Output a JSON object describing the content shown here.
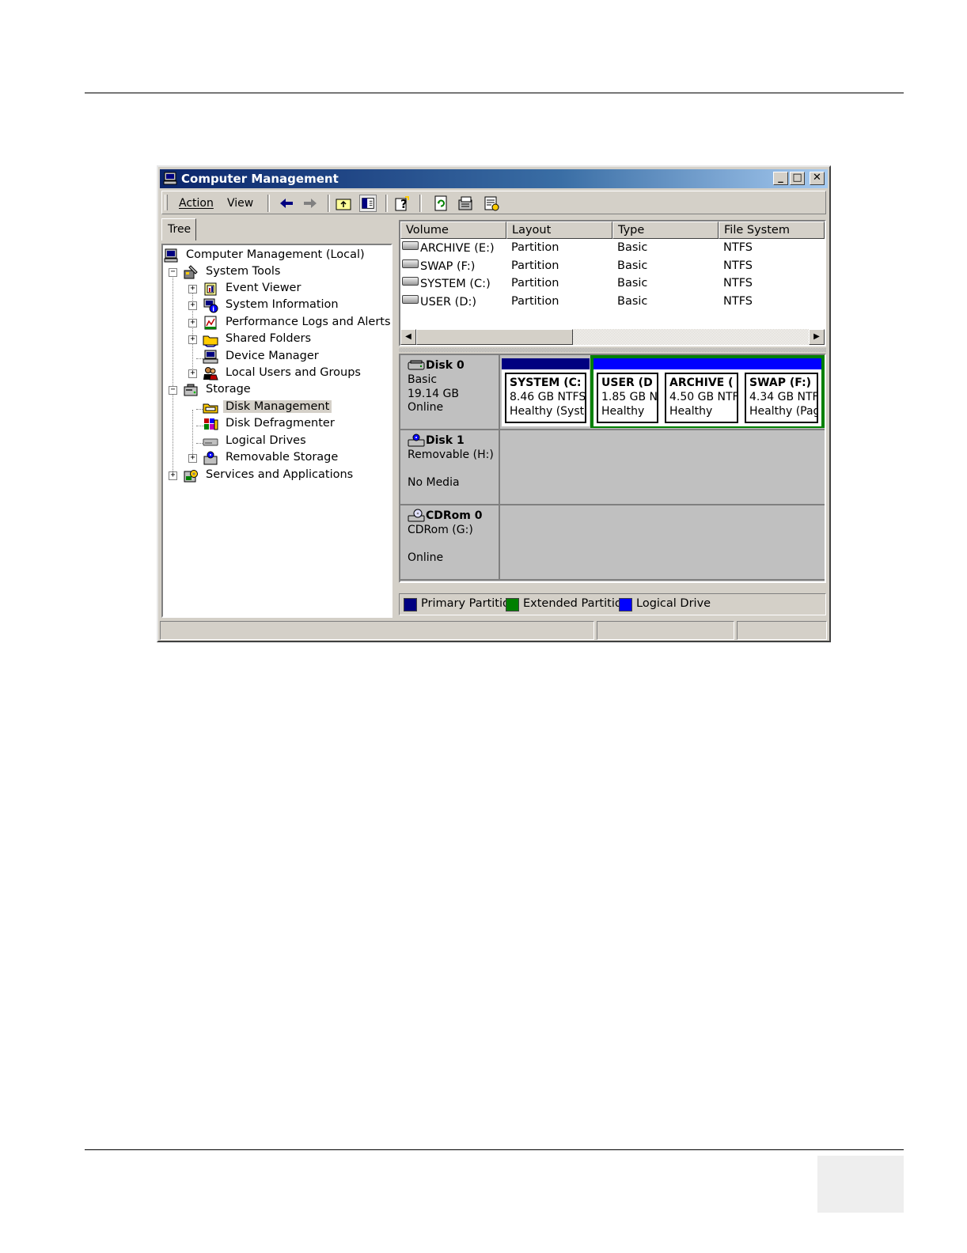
{
  "window": {
    "title": "Computer Management",
    "caption_buttons": [
      "_",
      "□",
      "✕"
    ]
  },
  "menu": {
    "action": "Action",
    "view": "View"
  },
  "toolbar_icons": [
    "back-icon",
    "forward-icon",
    "up-folder-icon",
    "show-hide-tree-icon",
    "help-icon",
    "refresh-icon",
    "properties-icon",
    "export-icon"
  ],
  "tree": {
    "tab": "Tree",
    "root": "Computer Management (Local)",
    "system_tools": "System Tools",
    "event_viewer": "Event Viewer",
    "system_information": "System Information",
    "performance_logs": "Performance Logs and Alerts",
    "shared_folders": "Shared Folders",
    "device_manager": "Device Manager",
    "local_users": "Local Users and Groups",
    "storage": "Storage",
    "disk_management": "Disk Management",
    "disk_defragmenter": "Disk Defragmenter",
    "logical_drives": "Logical Drives",
    "removable_storage": "Removable Storage",
    "services_apps": "Services and Applications"
  },
  "volumes": {
    "headers": [
      "Volume",
      "Layout",
      "Type",
      "File System"
    ],
    "rows": [
      [
        "ARCHIVE (E:)",
        "Partition",
        "Basic",
        "NTFS"
      ],
      [
        "SWAP (F:)",
        "Partition",
        "Basic",
        "NTFS"
      ],
      [
        "SYSTEM (C:)",
        "Partition",
        "Basic",
        "NTFS"
      ],
      [
        "USER (D:)",
        "Partition",
        "Basic",
        "NTFS"
      ]
    ]
  },
  "disks": {
    "disk0": {
      "name": "Disk 0",
      "type": "Basic",
      "size": "19.14 GB",
      "status": "Online",
      "partitions": [
        {
          "name": "SYSTEM (C:",
          "size": "8.46 GB NTFS",
          "status": "Healthy (Syste"
        },
        {
          "name": "USER (D",
          "size": "1.85 GB N",
          "status": "Healthy"
        },
        {
          "name": "ARCHIVE (",
          "size": "4.50 GB NTF",
          "status": "Healthy"
        },
        {
          "name": "SWAP (F:)",
          "size": "4.34 GB NTF",
          "status": "Healthy (Pag"
        }
      ]
    },
    "disk1": {
      "name": "Disk 1",
      "type": "Removable (H:)",
      "status": "No Media"
    },
    "cdrom0": {
      "name": "CDRom 0",
      "type": "CDRom (G:)",
      "status": "Online"
    }
  },
  "legend": {
    "primary": "Primary Partition",
    "extended": "Extended Partition",
    "logical": "Logical Drive"
  },
  "colors": {
    "primary": "#000080",
    "extended": "#008000",
    "logical": "#0000ff",
    "title_start": "#0a246a",
    "title_end": "#a6caf0"
  }
}
